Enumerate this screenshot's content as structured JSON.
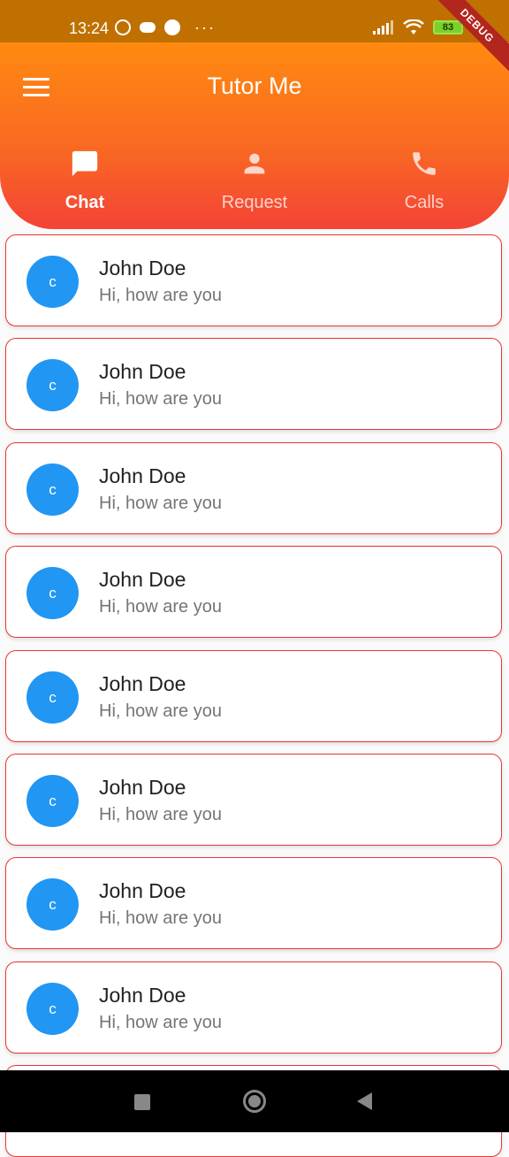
{
  "status_bar": {
    "time": "13:24",
    "battery": "83",
    "debug_label": "DEBUG"
  },
  "app_bar": {
    "title": "Tutor Me"
  },
  "tabs": [
    {
      "label": "Chat",
      "icon": "chat-bubble-icon",
      "active": true
    },
    {
      "label": "Request",
      "icon": "person-icon",
      "active": false
    },
    {
      "label": "Calls",
      "icon": "phone-icon",
      "active": false
    }
  ],
  "chats": [
    {
      "initial": "c",
      "name": "John Doe",
      "message": "Hi, how are you"
    },
    {
      "initial": "c",
      "name": "John Doe",
      "message": "Hi, how are you"
    },
    {
      "initial": "c",
      "name": "John Doe",
      "message": "Hi, how are you"
    },
    {
      "initial": "c",
      "name": "John Doe",
      "message": "Hi, how are you"
    },
    {
      "initial": "c",
      "name": "John Doe",
      "message": "Hi, how are you"
    },
    {
      "initial": "c",
      "name": "John Doe",
      "message": "Hi, how are you"
    },
    {
      "initial": "c",
      "name": "John Doe",
      "message": "Hi, how are you"
    },
    {
      "initial": "c",
      "name": "John Doe",
      "message": "Hi, how are you"
    }
  ],
  "colors": {
    "header_top": "#ff8a10",
    "header_bottom": "#f44336",
    "avatar": "#2196f3",
    "card_border": "#e53935"
  }
}
